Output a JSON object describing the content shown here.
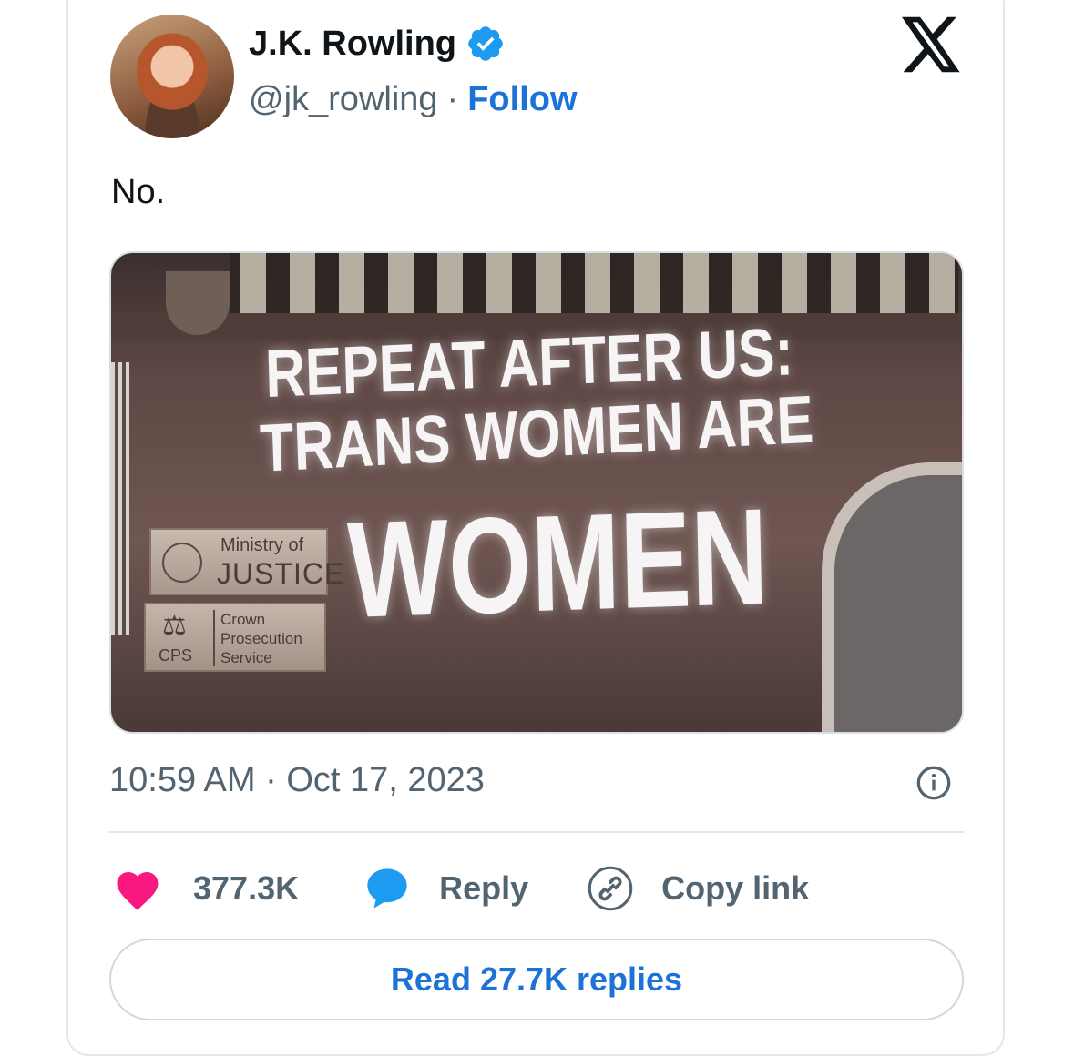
{
  "author": {
    "name": "J.K. Rowling",
    "handle": "@jk_rowling",
    "separator": "·",
    "follow_label": "Follow",
    "verified": true
  },
  "tweet": {
    "text": "No.",
    "timestamp": "10:59 AM · Oct 17, 2023"
  },
  "media": {
    "projection_lines": [
      "REPEAT AFTER US:",
      "TRANS WOMEN ARE",
      "WOMEN"
    ],
    "plaque_ministry_small": "Ministry of",
    "plaque_ministry_large": "JUSTICE",
    "plaque_cps_abbr": "CPS",
    "plaque_cps_lines": [
      "Crown",
      "Prosecution",
      "Service"
    ]
  },
  "actions": {
    "likes": "377.3K",
    "reply_label": "Reply",
    "copy_link_label": "Copy link",
    "read_replies_label": "Read 27.7K replies"
  },
  "colors": {
    "accent": "#1d72d6",
    "verified": "#1d9bf0",
    "heart": "#f91880",
    "secondary_text": "#536471",
    "primary_text": "#0f1419"
  },
  "icons": {
    "verified": "verified-badge-icon",
    "brand": "x-logo-icon",
    "info": "info-icon",
    "like": "heart-icon",
    "reply": "speech-bubble-icon",
    "copy": "link-icon"
  }
}
